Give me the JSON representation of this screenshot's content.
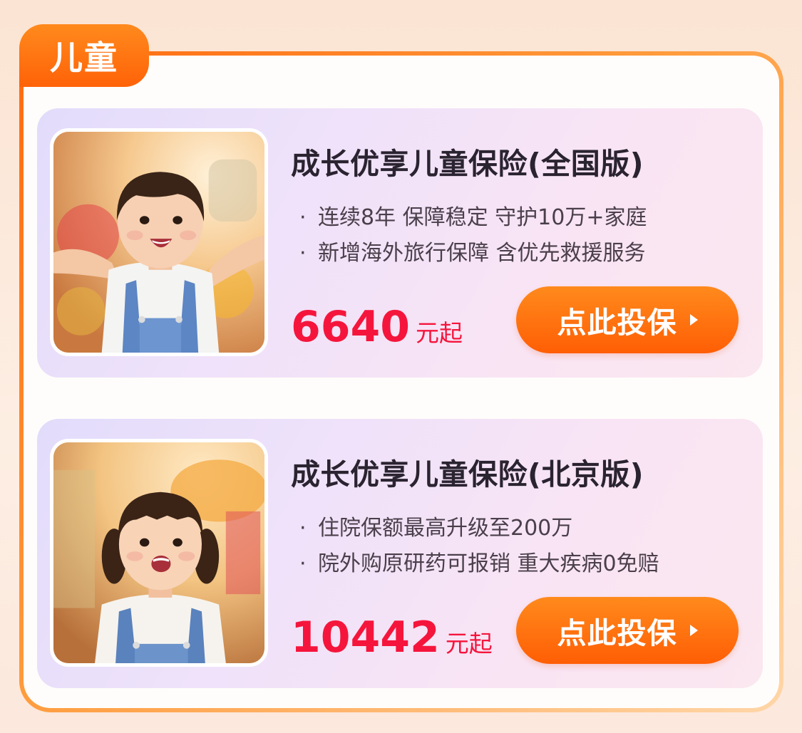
{
  "section": {
    "tab_label": "儿童"
  },
  "products": [
    {
      "title": "成长优享儿童保险(全国版)",
      "features": [
        "连续8年 保障稳定 守护10万+家庭",
        "新增海外旅行保障 含优先救援服务"
      ],
      "bullet": "·",
      "price": "6640",
      "price_unit": "元起",
      "cta_label": "点此投保",
      "image": "smiling-boy-in-overalls-photo"
    },
    {
      "title": "成长优享儿童保险(北京版)",
      "features": [
        "住院保额最高升级至200万",
        "院外购原研药可报销 重大疾病0免赔"
      ],
      "bullet": "·",
      "price": "10442",
      "price_unit": "元起",
      "cta_label": "点此投保",
      "image": "smiling-girl-with-pigtails-photo"
    }
  ],
  "colors": {
    "accent": "#ff6208",
    "price": "#f5153c",
    "title": "#2a2330",
    "body": "#4a3f4a"
  }
}
